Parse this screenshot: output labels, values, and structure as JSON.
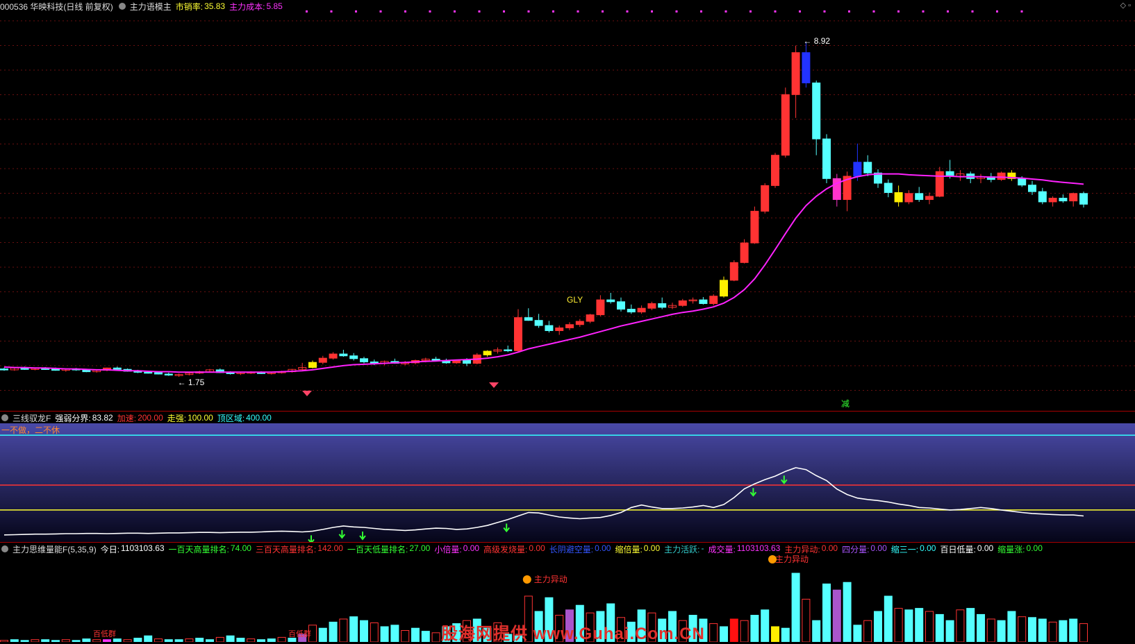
{
  "main_header": {
    "title": "000536 华映科技(日线 前复权)",
    "indicator": "主力语模主",
    "pe_label": "市销率:",
    "pe_value": "35.83",
    "cost_label": "主力成本:",
    "cost_value": "5.85",
    "cost_color": "#ff33ff"
  },
  "osc_header": {
    "name": "三线驭龙F",
    "items": [
      {
        "label": "强弱分界:",
        "value": "83.82",
        "color": "#ffffff"
      },
      {
        "label": "加速:",
        "value": "200.00",
        "color": "#ff3333"
      },
      {
        "label": "走强:",
        "value": "100.00",
        "color": "#ffff33"
      },
      {
        "label": "顶区域:",
        "value": "400.00",
        "color": "#33ffff"
      }
    ],
    "motto": "一不做，二不休"
  },
  "vol_header": {
    "name": "主力思维量能F(5,35,9)",
    "items": [
      {
        "label": "今日:",
        "value": "1103103.63",
        "color": "#ffffff"
      },
      {
        "label": "一百天高量排名:",
        "value": "74.00",
        "color": "#33ff33"
      },
      {
        "label": "三百天高量排名:",
        "value": "142.00",
        "color": "#ff3333"
      },
      {
        "label": "一百天低量排名:",
        "value": "27.00",
        "color": "#33ff33"
      },
      {
        "label": "小倍量:",
        "value": "0.00",
        "color": "#ff33ff"
      },
      {
        "label": "高级发烧量:",
        "value": "0.00",
        "color": "#ff3333"
      },
      {
        "label": "长阴避空量:",
        "value": "0.00",
        "color": "#3355ff"
      },
      {
        "label": "缩倍量:",
        "value": "0.00",
        "color": "#ffff33"
      },
      {
        "label": "主力活跃:",
        "value": "-",
        "color": "#33cccc"
      },
      {
        "label": "成交量:",
        "value": "1103103.63",
        "color": "#ff33ff"
      },
      {
        "label": "主力异动:",
        "value": "0.00",
        "color": "#ff3333"
      },
      {
        "label": "四分量:",
        "value": "0.00",
        "color": "#aa55ff"
      },
      {
        "label": "缩三一:",
        "value": "0.00",
        "color": "#33ffff"
      },
      {
        "label": "百日低量:",
        "value": "0.00",
        "color": "#ffffff"
      },
      {
        "label": "缩量涨:",
        "value": "0.00",
        "color": "#33ff33"
      }
    ]
  },
  "annotations": {
    "high_label": "8.92",
    "low_label": "1.75",
    "gly": "GLY",
    "jian": "减",
    "vol_abn1": "主力异动",
    "vol_abn2": "主力异动",
    "vol_low1": "百低群",
    "vol_low2": "百低群"
  },
  "watermark": "股海网提供 www.Guhai.Com.CN",
  "chart_data": [
    {
      "type": "candlestick",
      "ylim": [
        1.2,
        9.5
      ],
      "high_marker": 8.92,
      "low_marker": 1.75,
      "ohlc": [
        [
          1.92,
          1.95,
          1.88,
          1.9
        ],
        [
          1.9,
          1.96,
          1.88,
          1.94
        ],
        [
          1.94,
          1.97,
          1.9,
          1.91
        ],
        [
          1.91,
          1.95,
          1.89,
          1.93
        ],
        [
          1.93,
          1.96,
          1.9,
          1.92
        ],
        [
          1.92,
          1.95,
          1.88,
          1.89
        ],
        [
          1.89,
          1.93,
          1.86,
          1.92
        ],
        [
          1.92,
          1.94,
          1.88,
          1.9
        ],
        [
          1.9,
          1.92,
          1.85,
          1.86
        ],
        [
          1.86,
          1.9,
          1.84,
          1.89
        ],
        [
          1.89,
          1.95,
          1.87,
          1.94
        ],
        [
          1.94,
          1.97,
          1.9,
          1.91
        ],
        [
          1.91,
          1.93,
          1.86,
          1.87
        ],
        [
          1.87,
          1.9,
          1.83,
          1.85
        ],
        [
          1.85,
          1.88,
          1.82,
          1.84
        ],
        [
          1.84,
          1.86,
          1.8,
          1.81
        ],
        [
          1.81,
          1.84,
          1.77,
          1.79
        ],
        [
          1.79,
          1.82,
          1.75,
          1.8
        ],
        [
          1.8,
          1.85,
          1.78,
          1.83
        ],
        [
          1.83,
          1.88,
          1.81,
          1.86
        ],
        [
          1.86,
          1.92,
          1.84,
          1.9
        ],
        [
          1.9,
          1.93,
          1.83,
          1.84
        ],
        [
          1.84,
          1.87,
          1.8,
          1.82
        ],
        [
          1.82,
          1.85,
          1.79,
          1.84
        ],
        [
          1.84,
          1.87,
          1.81,
          1.85
        ],
        [
          1.85,
          1.87,
          1.81,
          1.82
        ],
        [
          1.82,
          1.86,
          1.8,
          1.84
        ],
        [
          1.84,
          1.88,
          1.82,
          1.86
        ],
        [
          1.86,
          1.92,
          1.84,
          1.91
        ],
        [
          1.91,
          2.05,
          1.89,
          1.95
        ],
        [
          1.95,
          2.1,
          1.93,
          2.06
        ],
        [
          2.06,
          2.2,
          2.02,
          2.15
        ],
        [
          2.15,
          2.28,
          2.12,
          2.24
        ],
        [
          2.24,
          2.33,
          2.18,
          2.2
        ],
        [
          2.2,
          2.26,
          2.1,
          2.14
        ],
        [
          2.14,
          2.18,
          2.04,
          2.07
        ],
        [
          2.07,
          2.12,
          2.0,
          2.04
        ],
        [
          2.04,
          2.1,
          2.0,
          2.08
        ],
        [
          2.08,
          2.14,
          2.03,
          2.04
        ],
        [
          2.04,
          2.09,
          2.0,
          2.05
        ],
        [
          2.05,
          2.12,
          2.02,
          2.1
        ],
        [
          2.1,
          2.16,
          2.06,
          2.13
        ],
        [
          2.13,
          2.18,
          2.08,
          2.1
        ],
        [
          2.1,
          2.14,
          2.03,
          2.05
        ],
        [
          2.05,
          2.12,
          2.03,
          2.11
        ],
        [
          2.11,
          2.15,
          1.98,
          2.04
        ],
        [
          2.04,
          2.26,
          2.02,
          2.22
        ],
        [
          2.22,
          2.32,
          2.18,
          2.3
        ],
        [
          2.3,
          2.38,
          2.25,
          2.33
        ],
        [
          2.33,
          2.42,
          2.28,
          2.31
        ],
        [
          2.31,
          3.2,
          2.29,
          3.02
        ],
        [
          3.02,
          3.22,
          2.95,
          2.96
        ],
        [
          2.96,
          3.1,
          2.8,
          2.85
        ],
        [
          2.85,
          2.95,
          2.7,
          2.74
        ],
        [
          2.74,
          2.85,
          2.65,
          2.8
        ],
        [
          2.8,
          2.92,
          2.75,
          2.87
        ],
        [
          2.87,
          2.99,
          2.82,
          2.94
        ],
        [
          2.94,
          3.1,
          2.9,
          3.08
        ],
        [
          3.08,
          3.5,
          3.05,
          3.4
        ],
        [
          3.4,
          3.55,
          3.32,
          3.36
        ],
        [
          3.36,
          3.45,
          3.15,
          3.2
        ],
        [
          3.2,
          3.3,
          3.1,
          3.14
        ],
        [
          3.14,
          3.28,
          3.1,
          3.22
        ],
        [
          3.22,
          3.36,
          3.18,
          3.32
        ],
        [
          3.32,
          3.45,
          3.2,
          3.24
        ],
        [
          3.24,
          3.34,
          3.2,
          3.28
        ],
        [
          3.28,
          3.42,
          3.25,
          3.38
        ],
        [
          3.38,
          3.45,
          3.32,
          3.4
        ],
        [
          3.4,
          3.46,
          3.3,
          3.32
        ],
        [
          3.32,
          3.52,
          3.28,
          3.48
        ],
        [
          3.48,
          3.9,
          3.45,
          3.82
        ],
        [
          3.82,
          4.25,
          3.8,
          4.2
        ],
        [
          4.2,
          4.7,
          4.18,
          4.62
        ],
        [
          4.62,
          5.4,
          4.6,
          5.3
        ],
        [
          5.3,
          5.9,
          5.25,
          5.85
        ],
        [
          5.85,
          6.55,
          5.8,
          6.5
        ],
        [
          6.5,
          7.95,
          6.45,
          7.8
        ],
        [
          7.8,
          8.85,
          7.3,
          8.7
        ],
        [
          8.7,
          8.92,
          7.95,
          8.05
        ],
        [
          8.05,
          8.1,
          6.5,
          6.85
        ],
        [
          6.85,
          6.95,
          5.9,
          6.0
        ],
        [
          6.0,
          6.1,
          5.4,
          5.55
        ],
        [
          5.55,
          6.15,
          5.3,
          6.05
        ],
        [
          6.05,
          6.75,
          5.95,
          6.35
        ],
        [
          6.35,
          6.5,
          6.05,
          6.12
        ],
        [
          6.12,
          6.2,
          5.8,
          5.9
        ],
        [
          5.9,
          5.98,
          5.6,
          5.7
        ],
        [
          5.7,
          5.85,
          5.4,
          5.5
        ],
        [
          5.5,
          5.75,
          5.45,
          5.68
        ],
        [
          5.68,
          5.82,
          5.5,
          5.55
        ],
        [
          5.55,
          5.7,
          5.45,
          5.62
        ],
        [
          5.62,
          6.25,
          5.6,
          6.15
        ],
        [
          6.15,
          6.4,
          6.0,
          6.05
        ],
        [
          6.05,
          6.18,
          5.95,
          6.1
        ],
        [
          6.1,
          6.15,
          5.9,
          6.0
        ],
        [
          6.0,
          6.1,
          5.9,
          6.04
        ],
        [
          6.04,
          6.12,
          5.92,
          5.98
        ],
        [
          5.98,
          6.15,
          5.95,
          6.12
        ],
        [
          6.12,
          6.18,
          5.95,
          6.0
        ],
        [
          6.0,
          6.05,
          5.82,
          5.86
        ],
        [
          5.86,
          5.95,
          5.65,
          5.72
        ],
        [
          5.72,
          5.8,
          5.45,
          5.5
        ],
        [
          5.5,
          5.62,
          5.4,
          5.58
        ],
        [
          5.58,
          5.66,
          5.48,
          5.52
        ],
        [
          5.52,
          5.7,
          5.4,
          5.68
        ],
        [
          5.68,
          5.72,
          5.38,
          5.45
        ]
      ],
      "ma": [
        1.96,
        1.95,
        1.95,
        1.94,
        1.94,
        1.93,
        1.92,
        1.92,
        1.91,
        1.9,
        1.9,
        1.89,
        1.88,
        1.88,
        1.87,
        1.86,
        1.86,
        1.85,
        1.85,
        1.85,
        1.85,
        1.85,
        1.85,
        1.85,
        1.85,
        1.85,
        1.85,
        1.86,
        1.87,
        1.88,
        1.9,
        1.93,
        1.96,
        1.99,
        2.01,
        2.02,
        2.03,
        2.04,
        2.05,
        2.06,
        2.07,
        2.08,
        2.09,
        2.1,
        2.11,
        2.12,
        2.13,
        2.15,
        2.18,
        2.22,
        2.28,
        2.35,
        2.4,
        2.45,
        2.5,
        2.55,
        2.6,
        2.66,
        2.72,
        2.78,
        2.84,
        2.89,
        2.94,
        2.99,
        3.04,
        3.09,
        3.13,
        3.16,
        3.2,
        3.25,
        3.33,
        3.45,
        3.62,
        3.85,
        4.15,
        4.48,
        4.82,
        5.15,
        5.42,
        5.62,
        5.78,
        5.9,
        5.98,
        6.04,
        6.08,
        6.1,
        6.1,
        6.1,
        6.08,
        6.07,
        6.06,
        6.05,
        6.05,
        6.04,
        6.04,
        6.04,
        6.03,
        6.03,
        6.02,
        6.01,
        5.99,
        5.97,
        5.94,
        5.92,
        5.9,
        5.88
      ]
    },
    {
      "type": "line",
      "name": "三线驭龙F",
      "ylim": [
        -20,
        420
      ],
      "hlines": [
        400,
        200,
        100
      ],
      "values": [
        0,
        1,
        2,
        3,
        3,
        4,
        5,
        5,
        6,
        6,
        5,
        6,
        7,
        7,
        6,
        7,
        8,
        8,
        9,
        10,
        10,
        9,
        10,
        11,
        11,
        12,
        14,
        15,
        14,
        12,
        15,
        22,
        30,
        36,
        32,
        30,
        26,
        22,
        20,
        18,
        20,
        24,
        27,
        26,
        22,
        24,
        30,
        38,
        50,
        62,
        76,
        90,
        88,
        80,
        72,
        68,
        65,
        68,
        70,
        78,
        90,
        110,
        120,
        112,
        106,
        106,
        108,
        112,
        118,
        110,
        122,
        150,
        185,
        205,
        222,
        236,
        255,
        270,
        262,
        238,
        218,
        184,
        162,
        148,
        142,
        138,
        132,
        124,
        118,
        110,
        108,
        104,
        100,
        102,
        106,
        110,
        106,
        100,
        95,
        90,
        86,
        84,
        82,
        80,
        80,
        76
      ]
    },
    {
      "type": "bar",
      "name": "主力思维量能F(5,35,9)",
      "ylim": [
        0,
        100
      ],
      "values": [
        2,
        3,
        2,
        3,
        3,
        2,
        3,
        2,
        4,
        3,
        3,
        4,
        3,
        5,
        8,
        4,
        3,
        3,
        4,
        5,
        3,
        6,
        8,
        5,
        4,
        3,
        4,
        6,
        5,
        10,
        22,
        18,
        26,
        30,
        33,
        28,
        25,
        20,
        22,
        15,
        18,
        14,
        12,
        20,
        24,
        28,
        30,
        18,
        25,
        10,
        8,
        60,
        40,
        58,
        35,
        42,
        48,
        38,
        40,
        50,
        32,
        26,
        42,
        38,
        30,
        40,
        28,
        35,
        30,
        24,
        20,
        30,
        28,
        35,
        42,
        20,
        18,
        90,
        56,
        28,
        76,
        68,
        78,
        22,
        28,
        40,
        60,
        44,
        42,
        44,
        40,
        36,
        28,
        42,
        44,
        36,
        30,
        28,
        40,
        33,
        32,
        30,
        26,
        28,
        30,
        24
      ]
    }
  ]
}
